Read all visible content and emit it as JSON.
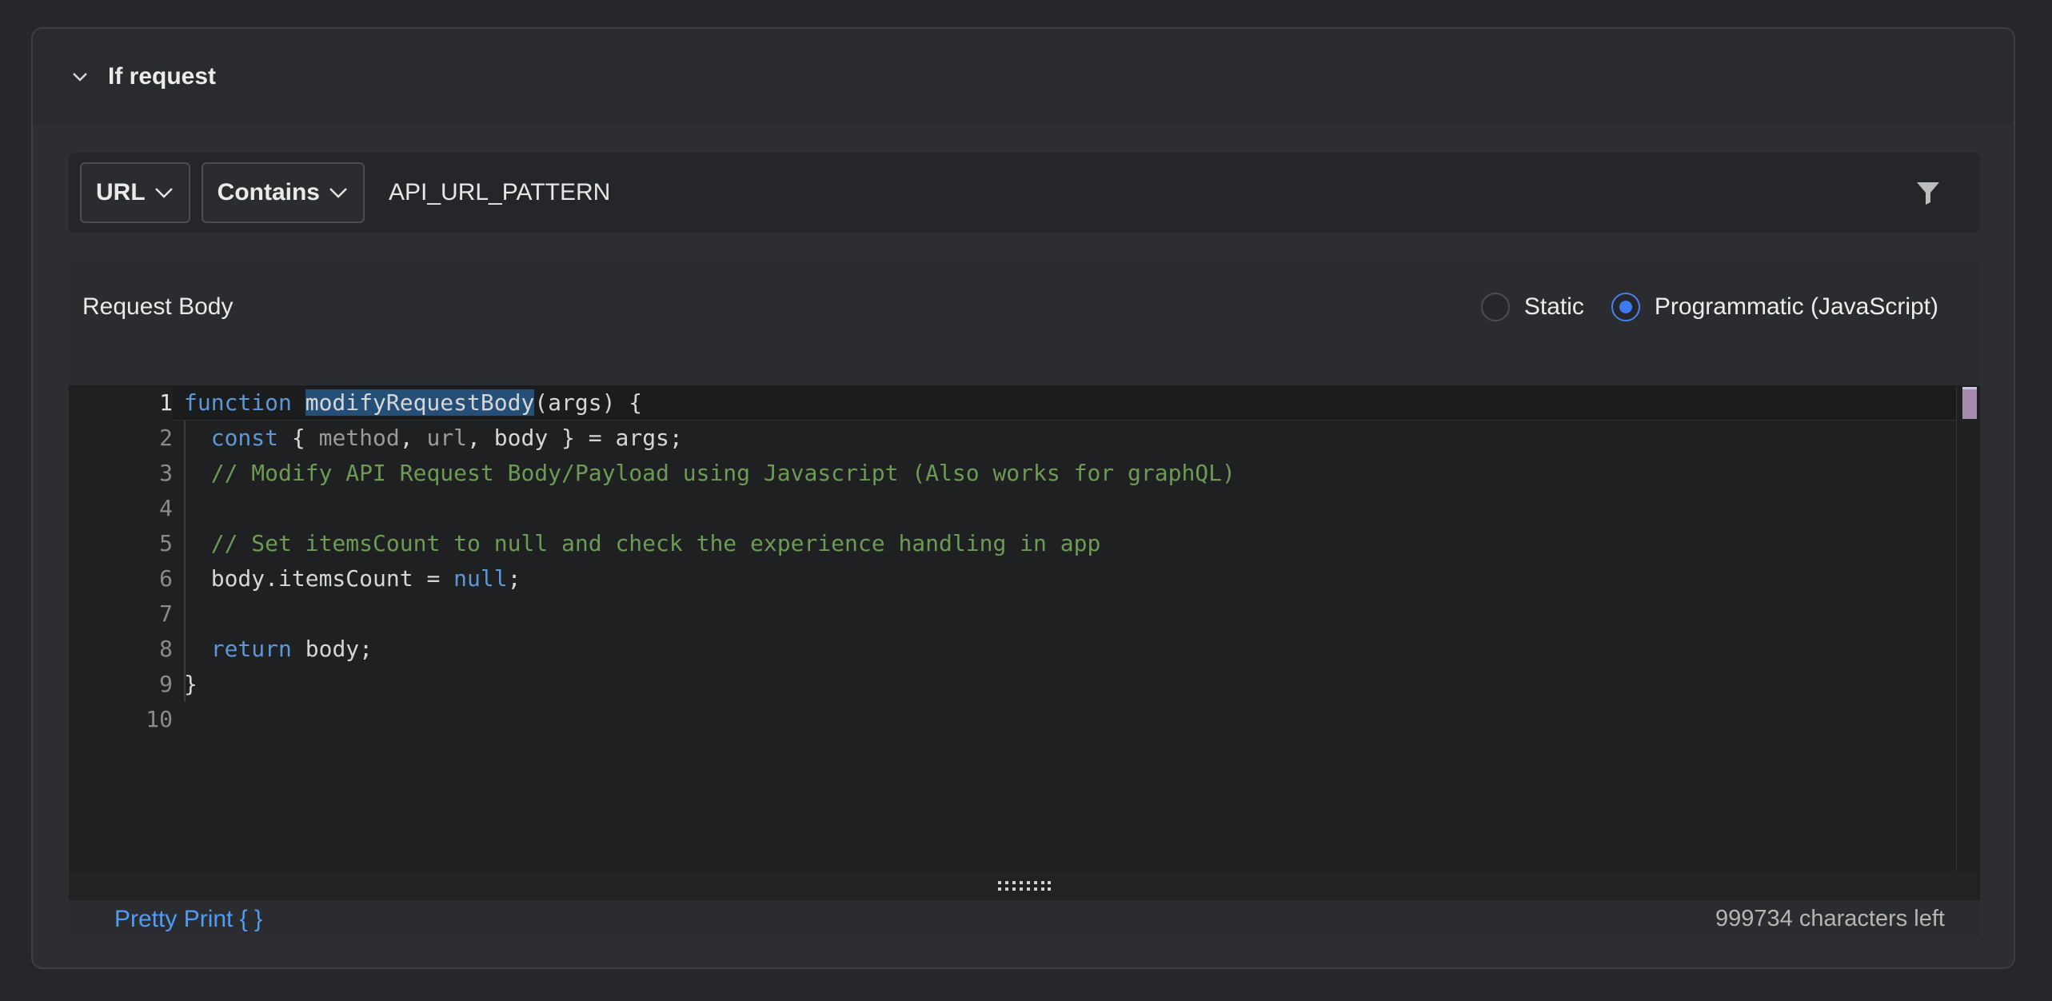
{
  "section": {
    "title": "If request",
    "collapse_icon": "chevron-down-icon"
  },
  "filter": {
    "field_label": "URL",
    "operator_label": "Contains",
    "value": "API_URL_PATTERN",
    "filter_icon": "funnel-icon"
  },
  "request_body": {
    "label": "Request Body",
    "mode_options": [
      {
        "label": "Static",
        "selected": false
      },
      {
        "label": "Programmatic (JavaScript)",
        "selected": true
      }
    ],
    "editor": {
      "line_numbers": [
        "1",
        "2",
        "3",
        "4",
        "5",
        "6",
        "7",
        "8",
        "9",
        "10"
      ],
      "lines": {
        "l1_kw": "function",
        "l1_fn": "modifyRequestBody",
        "l1_rest": "(args) {",
        "l2_kw": "const",
        "l2_a": " { ",
        "l2_m": "method",
        "l2_b": ", ",
        "l2_u": "url",
        "l2_c": ", body } = args;",
        "l3": "// Modify API Request Body/Payload using Javascript (Also works for graphQL)",
        "l5": "// Set itemsCount to null and check the experience handling in app",
        "l6_a": "body.itemsCount = ",
        "l6_null": "null",
        "l6_b": ";",
        "l8_kw": "return",
        "l8_rest": " body;",
        "l9": "}"
      }
    },
    "pretty_print_label": "Pretty Print { }",
    "chars_left": "999734 characters left"
  },
  "colors": {
    "accent": "#4e9cf4",
    "radio_selected": "#3f78f0",
    "keyword": "#5d97d6",
    "comment": "#6d9a55",
    "selection": "#264f78"
  }
}
